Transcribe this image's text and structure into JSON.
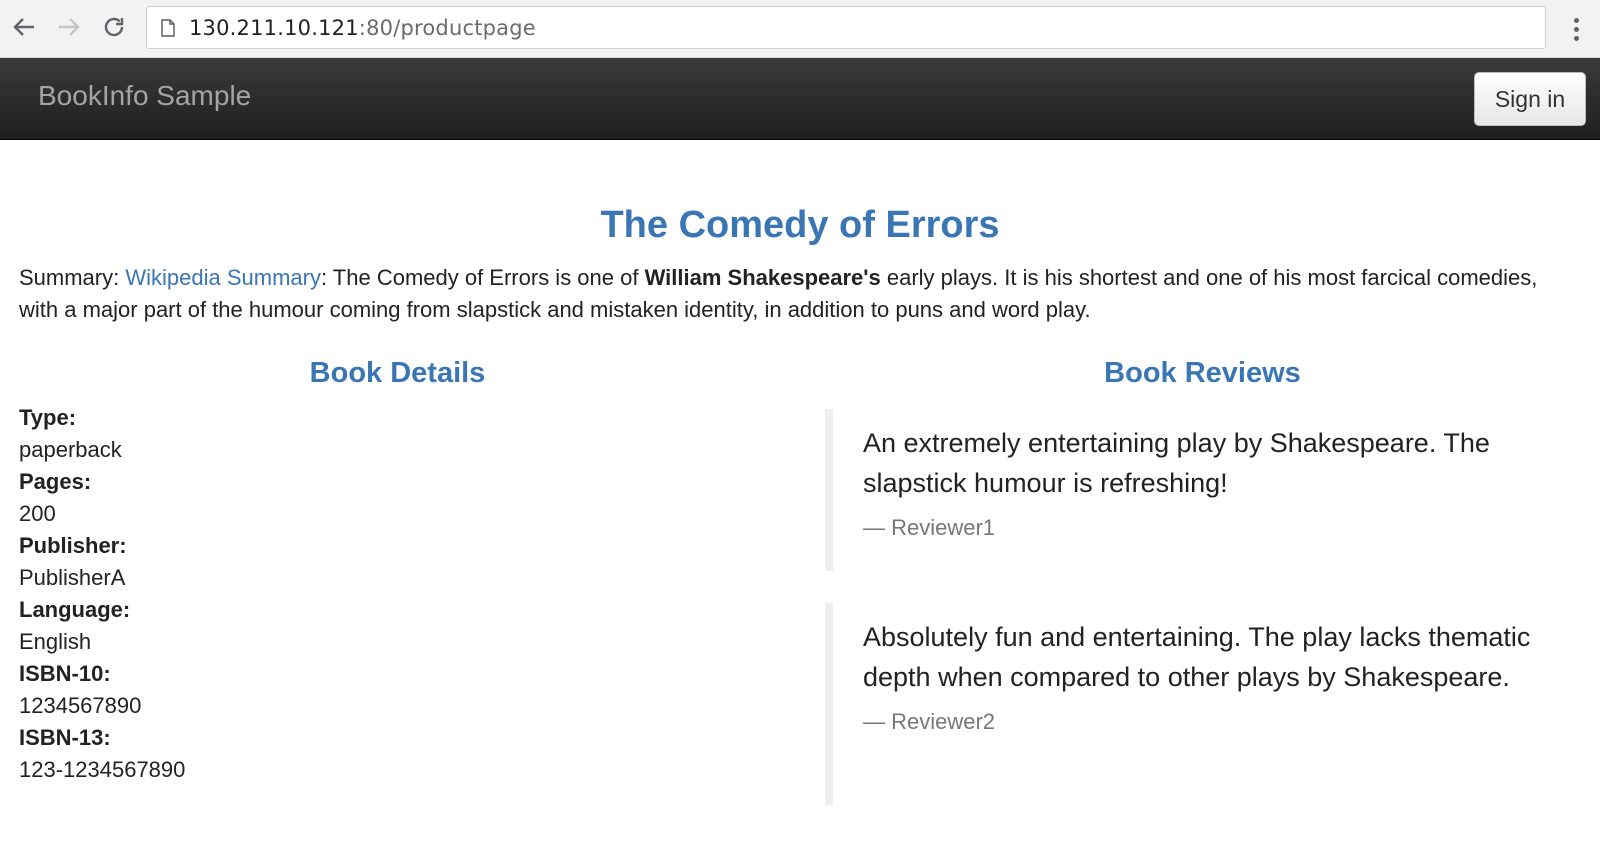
{
  "browser": {
    "url_host": "130.211.10.121",
    "url_rest": ":80/productpage",
    "icons": {
      "back": "arrow-left-icon",
      "forward": "arrow-right-icon",
      "reload": "reload-icon",
      "page": "page-icon",
      "menu": "vertical-dots-menu-icon"
    }
  },
  "navbar": {
    "brand": "BookInfo Sample",
    "sign_in": "Sign in"
  },
  "product": {
    "title": "The Comedy of Errors",
    "summary_label": "Summary: ",
    "summary_link": "Wikipedia Summary",
    "summary_text_1": ": The Comedy of Errors is one of ",
    "summary_bold": "William Shakespeare's",
    "summary_text_2": " early plays. It is his shortest and one of his most farcical comedies, with a major part of the humour coming from slapstick and mistaken identity, in addition to puns and word play."
  },
  "details": {
    "heading": "Book Details",
    "items": [
      {
        "label": "Type:",
        "value": "paperback"
      },
      {
        "label": "Pages:",
        "value": "200"
      },
      {
        "label": "Publisher:",
        "value": "PublisherA"
      },
      {
        "label": "Language:",
        "value": "English"
      },
      {
        "label": "ISBN-10:",
        "value": "1234567890"
      },
      {
        "label": "ISBN-13:",
        "value": "123-1234567890"
      }
    ]
  },
  "reviews": {
    "heading": "Book Reviews",
    "items": [
      {
        "text": "An extremely entertaining play by Shakespeare. The slapstick humour is refreshing!",
        "reviewer": "— Reviewer1"
      },
      {
        "text": "Absolutely fun and entertaining. The play lacks thematic depth when compared to other plays by Shakespeare.",
        "reviewer": "— Reviewer2"
      }
    ]
  },
  "colors": {
    "accent": "#3a76b3",
    "navbar": "#2a2a2a"
  }
}
